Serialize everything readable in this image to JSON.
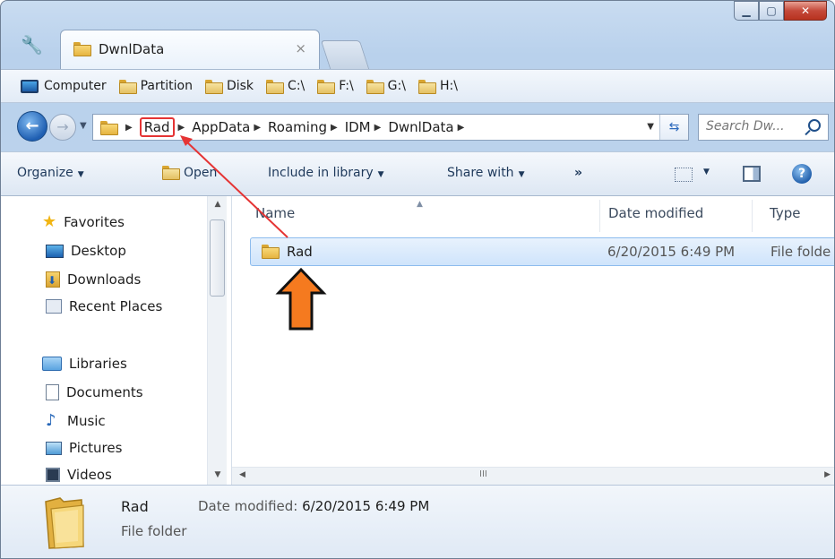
{
  "window": {
    "tab_title": "DwnlData",
    "tab_close": "×"
  },
  "favorites_bar": {
    "items": [
      "Computer",
      "Partition",
      "Disk",
      "C:\\",
      "F:\\",
      "G:\\",
      "H:\\"
    ]
  },
  "address": {
    "crumbs": [
      "Rad",
      "AppData",
      "Roaming",
      "IDM",
      "DwnlData"
    ],
    "search_placeholder": "Search Dw..."
  },
  "command_bar": {
    "organize": "Organize",
    "open": "Open",
    "include_in_library": "Include in library",
    "share_with": "Share with",
    "more": "»"
  },
  "nav_pane": {
    "favorites": "Favorites",
    "desktop": "Desktop",
    "downloads": "Downloads",
    "recent_places": "Recent Places",
    "libraries": "Libraries",
    "documents": "Documents",
    "music": "Music",
    "pictures": "Pictures",
    "videos": "Videos"
  },
  "columns": {
    "name": "Name",
    "date_modified": "Date modified",
    "type": "Type"
  },
  "rows": [
    {
      "name": "Rad",
      "date": "6/20/2015 6:49 PM",
      "type": "File folde"
    }
  ],
  "details": {
    "name": "Rad",
    "type": "File folder",
    "date_label": "Date modified:",
    "date_value": "6/20/2015 6:49 PM"
  },
  "annotations": {
    "highlight_color": "#e53434",
    "arrow_color": "#f57a1f"
  }
}
